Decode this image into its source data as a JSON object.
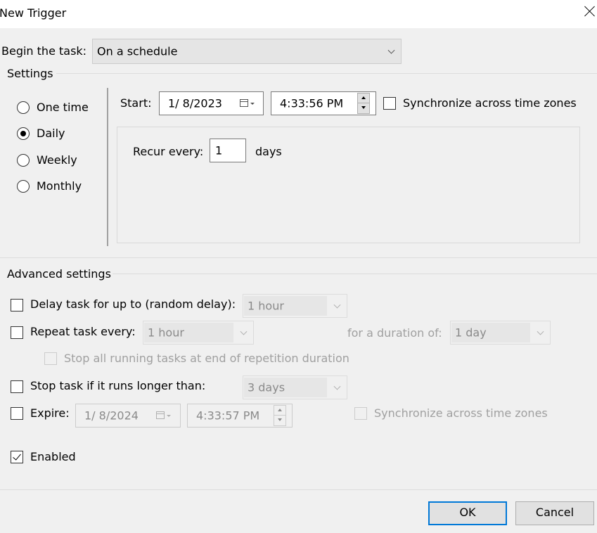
{
  "window": {
    "title": "New Trigger"
  },
  "begin_task": {
    "label": "Begin the task:",
    "value": "On a schedule"
  },
  "settings": {
    "group_label": "Settings",
    "options": [
      {
        "label": "One time",
        "checked": false
      },
      {
        "label": "Daily",
        "checked": true
      },
      {
        "label": "Weekly",
        "checked": false
      },
      {
        "label": "Monthly",
        "checked": false
      }
    ],
    "start_label": "Start:",
    "start_date": "1/ 8/2023",
    "start_time": "4:33:56 PM",
    "sync_label": "Synchronize across time zones",
    "recur_label": "Recur every:",
    "recur_value": "1",
    "recur_unit": "days"
  },
  "advanced": {
    "group_label": "Advanced settings",
    "delay_label": "Delay task for up to (random delay):",
    "delay_value": "1 hour",
    "repeat_label": "Repeat task every:",
    "repeat_value": "1 hour",
    "duration_label": "for a duration of:",
    "duration_value": "1 day",
    "stop_all_label": "Stop all running tasks at end of repetition duration",
    "stop_longer_label": "Stop task if it runs longer than:",
    "stop_longer_value": "3 days",
    "expire_label": "Expire:",
    "expire_date": "1/ 8/2024",
    "expire_time": "4:33:57 PM",
    "expire_sync_label": "Synchronize across time zones",
    "enabled_label": "Enabled"
  },
  "buttons": {
    "ok": "OK",
    "cancel": "Cancel"
  }
}
